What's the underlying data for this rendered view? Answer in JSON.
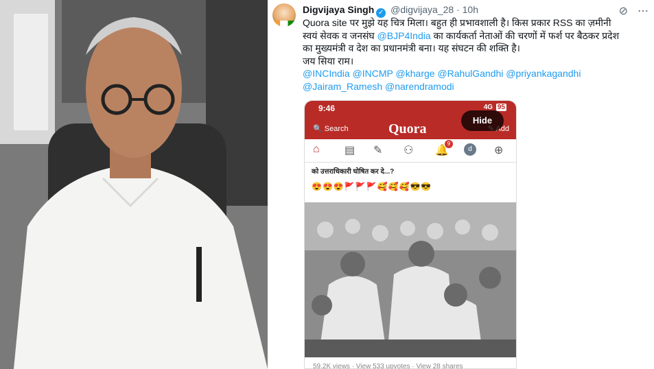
{
  "tweet": {
    "author_name": "Digvijaya Singh",
    "handle": "@digvijaya_28",
    "separator": "·",
    "time": "10h",
    "body_line1": "Quora site पर मुझे यह चित्र मिला। बहुत ही प्रभावशाली है। किस प्रकार RSS का ज़मीनी",
    "body_line2_pre": "स्वयं सेवक व जनसंघ ",
    "body_line2_mention": "@BJP4India",
    "body_line2_post": " का कार्यकर्ता नेताओं की चरणों में फर्श पर बैठकर प्रदेश",
    "body_line3": "का मुख्यमंत्री व देश का प्रधानमंत्री बना। यह संघटन की शक्ति है।",
    "body_line4": "जय सिया राम।",
    "mentions_line1": "@INCIndia @INCMP @kharge @RahulGandhi @priyankagandhi",
    "mentions_line2": "@Jairam_Ramesh @narendramodi"
  },
  "header_icons": [
    "grok-icon",
    "more-icon"
  ],
  "phone": {
    "time": "9:46",
    "network": "4G",
    "battery": "95",
    "search_label": "Search",
    "logo": "Quora",
    "add_label": "Add",
    "hide_button": "Hide",
    "notification_count": "9",
    "profile_initial": "d",
    "question_text": "को उत्तराधिकारी घोषित कर दे...?",
    "emojis": "😍😍😍🚩🚩🚩🥰🥰🥰😎😎",
    "stats": "59.2K views · View 533 upvotes · View 28 shares"
  },
  "colors": {
    "quora_red": "#b92b27",
    "link_blue": "#1d9bf0"
  }
}
